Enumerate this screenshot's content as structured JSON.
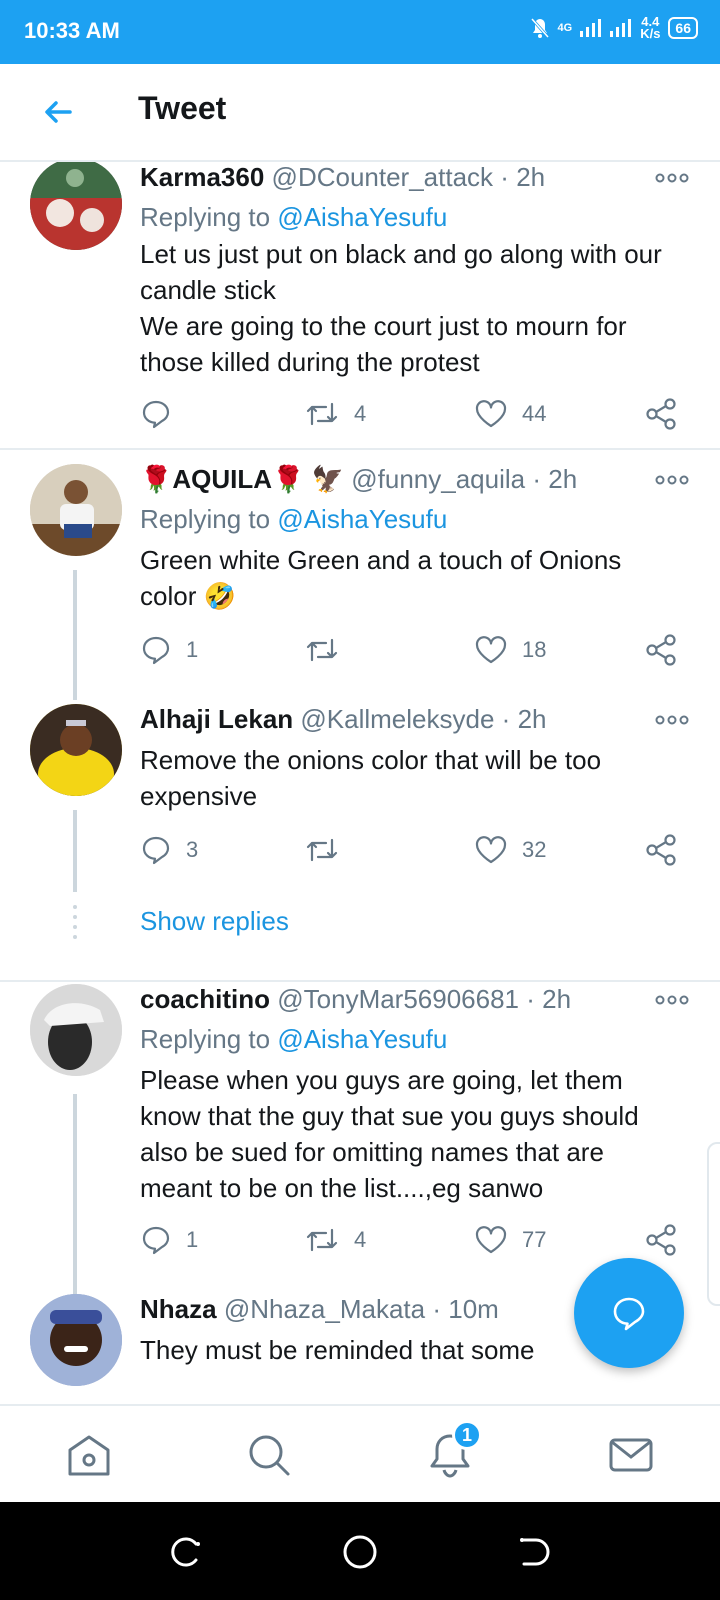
{
  "status_bar": {
    "time": "10:33 AM",
    "network": "4G",
    "speed_value": "4.4",
    "speed_unit": "K/s",
    "battery": "66"
  },
  "header": {
    "title": "Tweet"
  },
  "replying_label": "Replying to",
  "tweets": [
    {
      "name": "Karma360",
      "handle": "@DCounter_attack",
      "sep": "·",
      "time": "2h",
      "reply_to": "@AishaYesufu",
      "text": "Let us just put on black and go along with our candle stick\nWe are going to the court just to mourn for those killed during the protest",
      "replies": "",
      "retweets": "4",
      "likes": "44"
    },
    {
      "name": "AQUILA",
      "handle": "@funny_aquila",
      "sep": "·",
      "time": "2h",
      "reply_to": "@AishaYesufu",
      "text": "Green white Green and a touch of Onions color 🤣",
      "replies": "1",
      "retweets": "",
      "likes": "18"
    },
    {
      "name": "Alhaji Lekan",
      "handle": "@Kallmeleksyde",
      "sep": "·",
      "time": "2h",
      "text": "Remove the onions color that will be too expensive",
      "replies": "3",
      "retweets": "",
      "likes": "32"
    },
    {
      "name": "coachitino",
      "handle": "@TonyMar56906681",
      "sep": "·",
      "time": "2h",
      "reply_to": "@AishaYesufu",
      "text": "Please when you guys are going, let them know that the guy that sue you guys should also be sued for omitting names that are meant to be on the list....,eg sanwo",
      "replies": "1",
      "retweets": "4",
      "likes": "77"
    },
    {
      "name": "Nhaza",
      "handle": "@Nhaza_Makata",
      "sep": "·",
      "time": "10m",
      "text": "They must be reminded that some"
    }
  ],
  "show_replies": "Show replies",
  "notifications_badge": "1",
  "colors": {
    "brand": "#1da1f2",
    "link": "#1b95e0",
    "muted": "#657786",
    "divider": "#e6ecf0"
  },
  "icons": [
    "back-arrow-icon",
    "more-icon",
    "reply-icon",
    "retweet-icon",
    "like-icon",
    "share-icon",
    "compose-icon",
    "home-icon",
    "search-icon",
    "notifications-icon",
    "messages-icon"
  ]
}
